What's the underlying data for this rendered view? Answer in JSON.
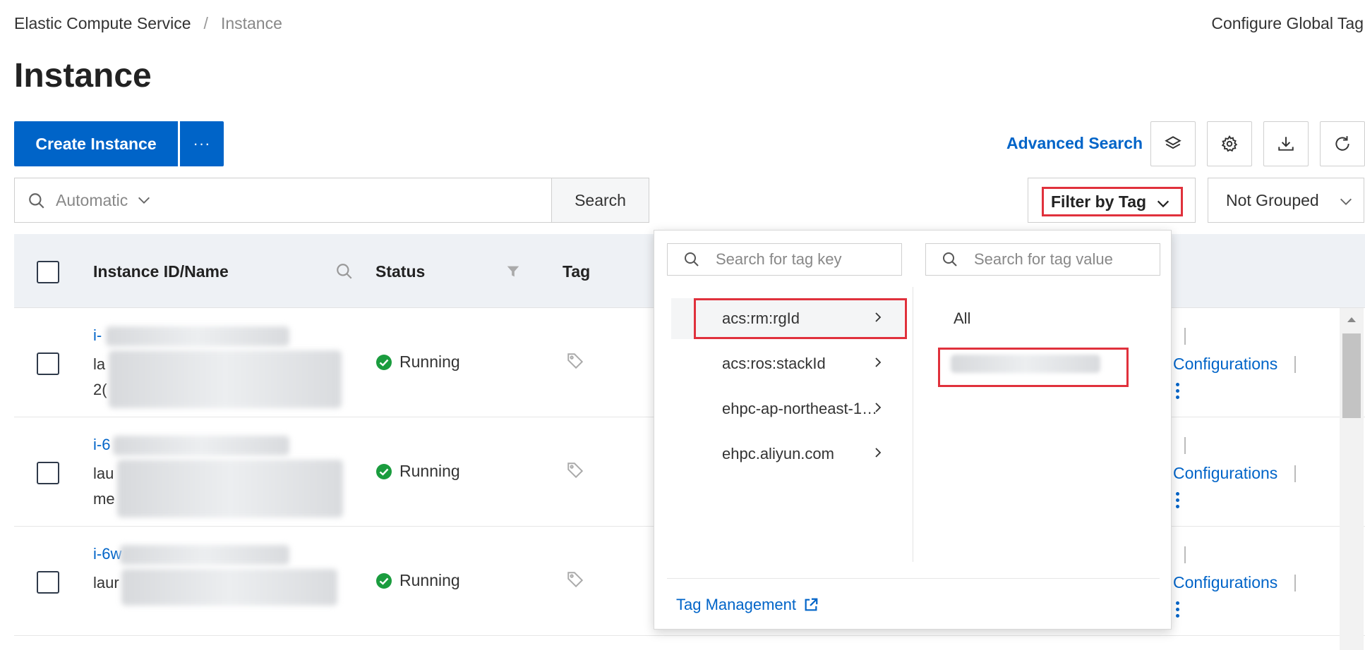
{
  "breadcrumb": {
    "root": "Elastic Compute Service",
    "separator": "/",
    "current": "Instance"
  },
  "header": {
    "global_tag_link": "Configure Global Tag",
    "title": "Instance"
  },
  "toolbar": {
    "create_label": "Create Instance",
    "more_label": "···",
    "advanced_search": "Advanced Search",
    "icons": [
      "layers-icon",
      "gear-icon",
      "download-icon",
      "refresh-icon"
    ]
  },
  "search": {
    "mode": "Automatic",
    "button": "Search"
  },
  "filters": {
    "filter_by_tag": "Filter by Tag",
    "group": "Not Grouped"
  },
  "table": {
    "columns": [
      "Instance ID/Name",
      "Status",
      "Tag"
    ],
    "rows": [
      {
        "id_prefix": "i-",
        "name_lines": [
          "la",
          "2("
        ],
        "status": "Running",
        "action": "Configurations"
      },
      {
        "id_prefix": "i-6",
        "name_lines": [
          "lau",
          "me"
        ],
        "status": "Running",
        "action": "Configurations"
      },
      {
        "id_prefix": "i-6w",
        "name_lines": [
          "laur"
        ],
        "status": "Running",
        "action": "Configurations"
      }
    ]
  },
  "tag_dropdown": {
    "key_placeholder": "Search for tag key",
    "value_placeholder": "Search for tag value",
    "keys": [
      "acs:rm:rgId",
      "acs:ros:stackId",
      "ehpc-ap-northeast-1…",
      "ehpc.aliyun.com"
    ],
    "active_key_index": 0,
    "values": [
      "All"
    ],
    "footer_link": "Tag Management"
  },
  "colors": {
    "primary": "#0064c8",
    "highlight_border": "#e0313c",
    "success": "#1a9c3e",
    "header_bg": "#eef1f5"
  }
}
